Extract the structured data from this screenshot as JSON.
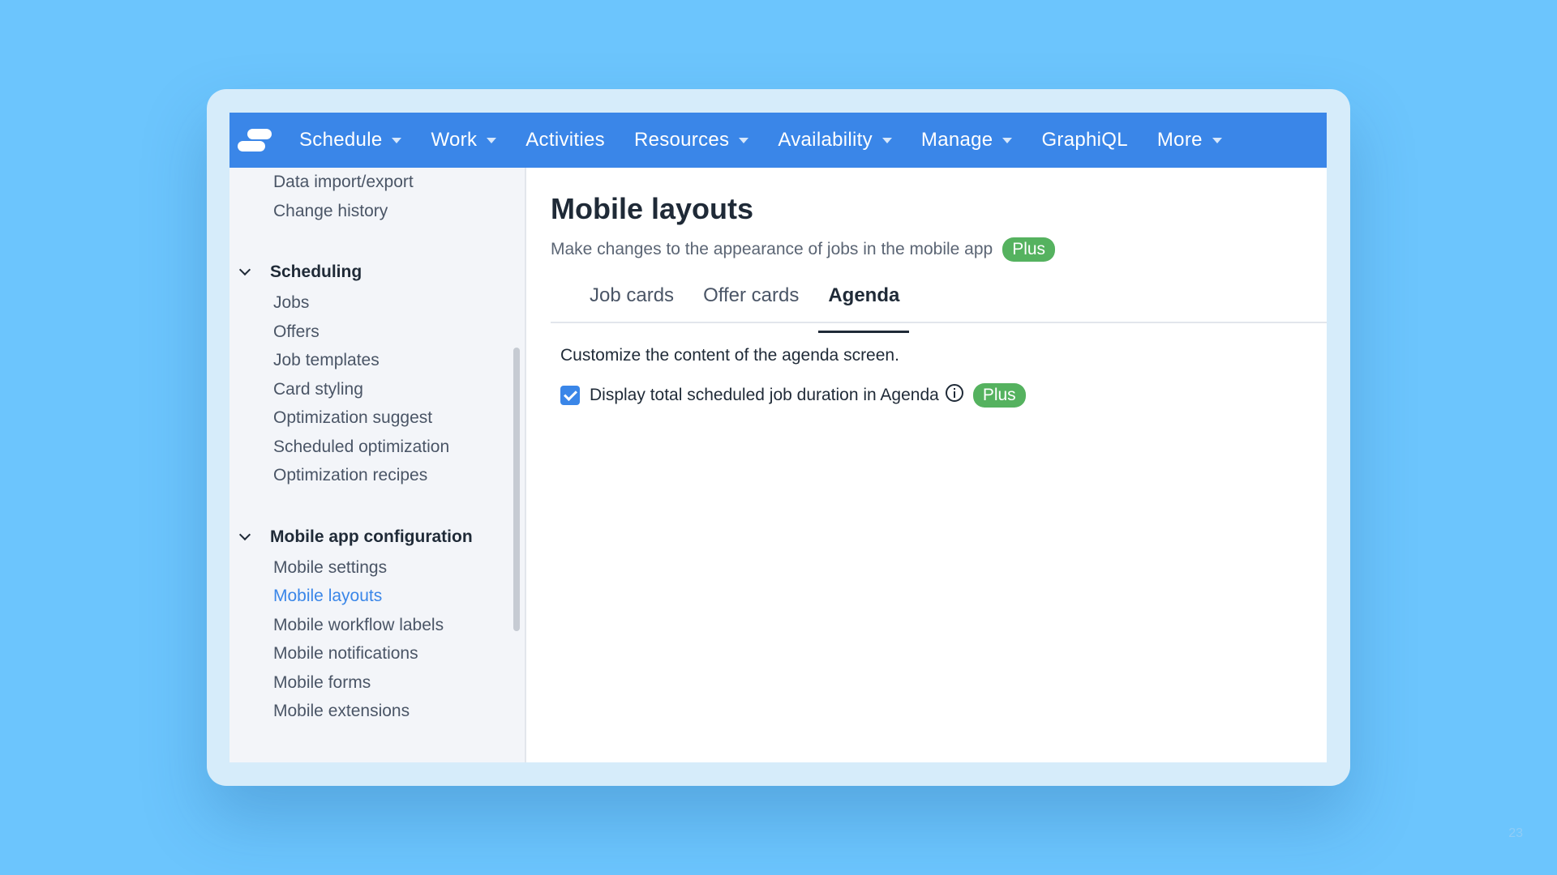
{
  "navbar": {
    "logo": "app-logo-icon",
    "items": [
      {
        "label": "Schedule",
        "dropdown": true
      },
      {
        "label": "Work",
        "dropdown": true
      },
      {
        "label": "Activities",
        "dropdown": false
      },
      {
        "label": "Resources",
        "dropdown": true
      },
      {
        "label": "Availability",
        "dropdown": true
      },
      {
        "label": "Manage",
        "dropdown": true
      },
      {
        "label": "GraphiQL",
        "dropdown": false
      },
      {
        "label": "More",
        "dropdown": true
      }
    ]
  },
  "sidebar": {
    "top_links": [
      "Data import/export",
      "Change history"
    ],
    "sections": [
      {
        "title": "Scheduling",
        "links": [
          "Jobs",
          "Offers",
          "Job templates",
          "Card styling",
          "Optimization suggest",
          "Scheduled optimization",
          "Optimization recipes"
        ]
      },
      {
        "title": "Mobile app configuration",
        "links": [
          "Mobile settings",
          "Mobile layouts",
          "Mobile workflow labels",
          "Mobile notifications",
          "Mobile forms",
          "Mobile extensions"
        ]
      }
    ],
    "active_link": "Mobile layouts"
  },
  "main": {
    "title": "Mobile layouts",
    "subtitle": "Make changes to the appearance of jobs in the mobile app",
    "plan_badge": "Plus",
    "tabs": [
      {
        "label": "Job cards",
        "active": false
      },
      {
        "label": "Offer cards",
        "active": false
      },
      {
        "label": "Agenda",
        "active": true
      }
    ],
    "description": "Customize the content of the agenda screen.",
    "option": {
      "label": "Display total scheduled job duration in Agenda",
      "checked": true,
      "badge": "Plus"
    }
  },
  "slide_number": "23",
  "colors": {
    "navbar": "#3a86e8",
    "badge": "#55b25f",
    "background": "#6cc5fd",
    "active_link": "#3a86e8"
  }
}
